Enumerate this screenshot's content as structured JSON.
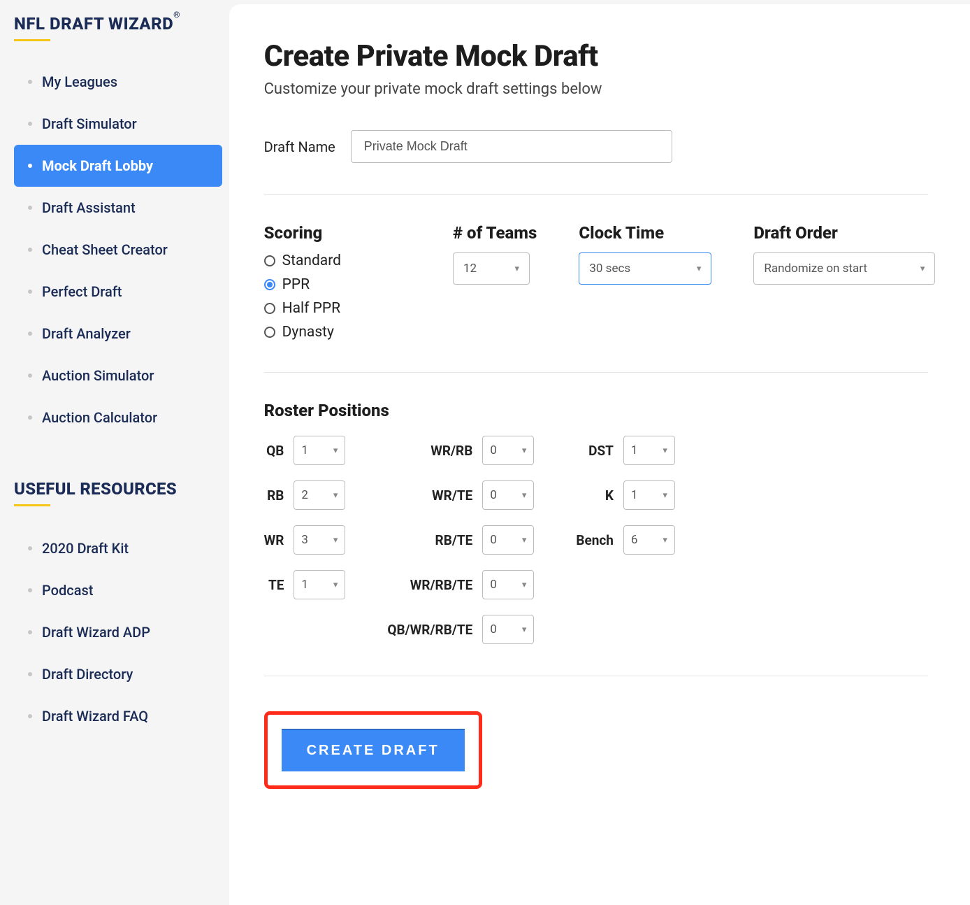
{
  "sidebar": {
    "brand_main": "NFL DRAFT WIZARD",
    "brand_reg": "®",
    "nav": [
      {
        "label": "My Leagues",
        "active": false
      },
      {
        "label": "Draft Simulator",
        "active": false
      },
      {
        "label": "Mock Draft Lobby",
        "active": true
      },
      {
        "label": "Draft Assistant",
        "active": false
      },
      {
        "label": "Cheat Sheet Creator",
        "active": false
      },
      {
        "label": "Perfect Draft",
        "active": false
      },
      {
        "label": "Draft Analyzer",
        "active": false
      },
      {
        "label": "Auction Simulator",
        "active": false
      },
      {
        "label": "Auction Calculator",
        "active": false
      }
    ],
    "resources_head": "USEFUL RESOURCES",
    "resources": [
      {
        "label": "2020 Draft Kit"
      },
      {
        "label": "Podcast"
      },
      {
        "label": "Draft Wizard ADP"
      },
      {
        "label": "Draft Directory"
      },
      {
        "label": "Draft Wizard FAQ"
      }
    ]
  },
  "page": {
    "title": "Create Private Mock Draft",
    "subtitle": "Customize your private mock draft settings below",
    "draft_name_label": "Draft Name",
    "draft_name_value": "Private Mock Draft"
  },
  "scoring": {
    "label": "Scoring",
    "options": [
      "Standard",
      "PPR",
      "Half PPR",
      "Dynasty"
    ],
    "selected": "PPR"
  },
  "teams": {
    "label": "# of Teams",
    "value": "12"
  },
  "clock": {
    "label": "Clock Time",
    "value": "30 secs"
  },
  "order": {
    "label": "Draft Order",
    "value": "Randomize on start"
  },
  "roster": {
    "label": "Roster Positions",
    "col1": [
      {
        "pos": "QB",
        "val": "1"
      },
      {
        "pos": "RB",
        "val": "2"
      },
      {
        "pos": "WR",
        "val": "3"
      },
      {
        "pos": "TE",
        "val": "1"
      }
    ],
    "col2": [
      {
        "pos": "WR/RB",
        "val": "0"
      },
      {
        "pos": "WR/TE",
        "val": "0"
      },
      {
        "pos": "RB/TE",
        "val": "0"
      },
      {
        "pos": "WR/RB/TE",
        "val": "0"
      },
      {
        "pos": "QB/WR/RB/TE",
        "val": "0"
      }
    ],
    "col3": [
      {
        "pos": "DST",
        "val": "1"
      },
      {
        "pos": "K",
        "val": "1"
      },
      {
        "pos": "Bench",
        "val": "6"
      }
    ]
  },
  "create_label": "CREATE DRAFT"
}
